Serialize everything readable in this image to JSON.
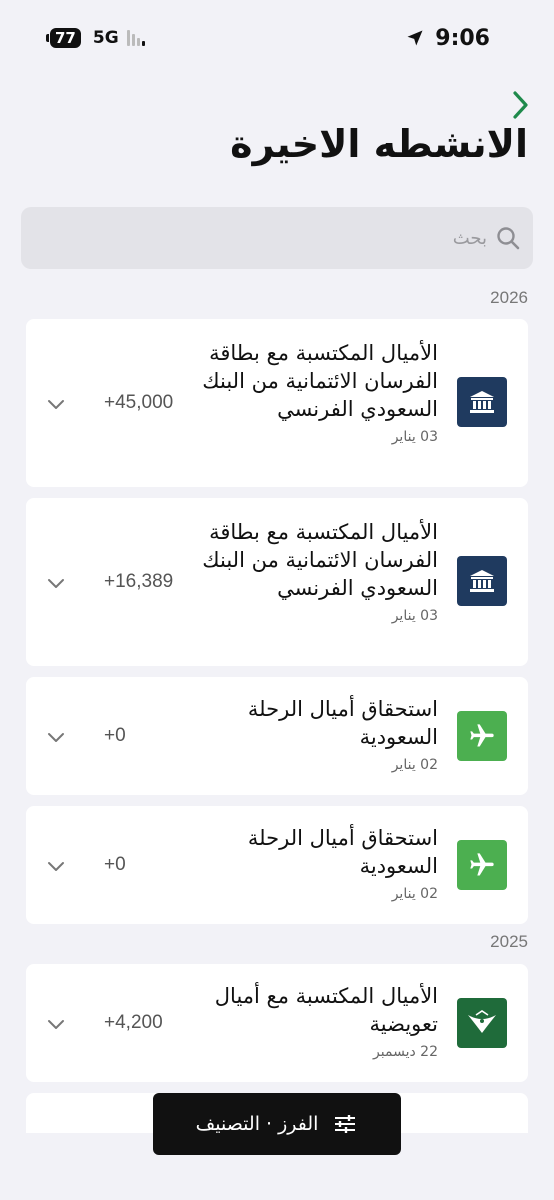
{
  "status_bar": {
    "battery": "77",
    "network": "5G",
    "time": "9:06"
  },
  "header": {
    "title": "الانشطه الاخيرة"
  },
  "search": {
    "placeholder": "بحث"
  },
  "years": [
    "2026",
    "2025"
  ],
  "activities": [
    {
      "icon": "bank-icon",
      "title": "الأميال المكتسبة مع بطاقة الفرسان الائتمانية من البنك السعودي الفرنسي",
      "date": "03 يناير",
      "amount": "+45,000"
    },
    {
      "icon": "bank-icon",
      "title": "الأميال المكتسبة مع بطاقة الفرسان الائتمانية من البنك السعودي الفرنسي",
      "date": "03 يناير",
      "amount": "+16,389"
    },
    {
      "icon": "airplane-icon",
      "title": "استحقاق أميال الرحلة السعودية",
      "date": "02 يناير",
      "amount": "+0"
    },
    {
      "icon": "airplane-icon",
      "title": "استحقاق أميال الرحلة السعودية",
      "date": "02 يناير",
      "amount": "+0"
    },
    {
      "icon": "saudia-logo-icon",
      "title": "الأميال المكتسبة مع أميال تعويضية",
      "date": "22 ديسمبر",
      "amount": "+4,200"
    }
  ],
  "bottom_button": {
    "label": "الفرز · التصنيف"
  },
  "colors": {
    "background": "#f2f2f7",
    "bank_tile": "#1f3a5f",
    "plane_tile": "#4caf50",
    "saudia_tile": "#1f6b3a",
    "accent_green": "#1f8a4c"
  }
}
